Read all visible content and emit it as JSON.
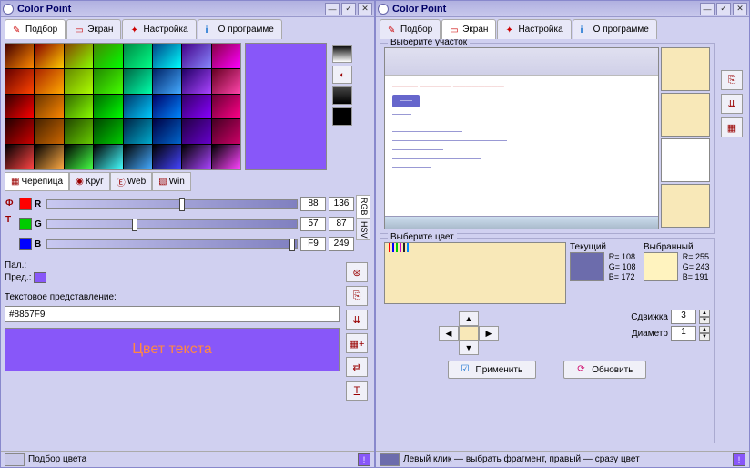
{
  "app_title": "Color Point",
  "tabs": {
    "pick": "Подбор",
    "screen": "Экран",
    "settings": "Настройка",
    "about": "О программе"
  },
  "pattern_tabs": {
    "tile": "Черепица",
    "circle": "Круг",
    "web": "Web",
    "win": "Win"
  },
  "rgb": {
    "r": {
      "label": "R",
      "hex": "88",
      "dec": "136",
      "pct": 53
    },
    "g": {
      "label": "G",
      "hex": "57",
      "dec": "87",
      "pct": 34
    },
    "b": {
      "label": "B",
      "hex": "F9",
      "dec": "249",
      "pct": 97
    }
  },
  "mode_tabs": {
    "rgb": "RGB",
    "hsv": "HSV"
  },
  "palette": {
    "pal_label": "Пал.:",
    "prev_label": "Пред.:",
    "text_repr_label": "Текстовое представление:",
    "hex_value": "#8857F9",
    "sample_text": "Цвет текста"
  },
  "colors": {
    "preview": "#8857F9",
    "sample_bg": "#8857F9",
    "sample_fg": "#ff8844"
  },
  "status_left": "Подбор цвета",
  "right": {
    "select_area": "Выберите участок",
    "select_color": "Выберите цвет",
    "current_label": "Текущий",
    "selected_label": "Выбранный",
    "current": {
      "r": "R= 108",
      "g": "G= 108",
      "b": "B= 172",
      "swatch": "#6c6cac"
    },
    "selected": {
      "r": "R= 255",
      "g": "G= 243",
      "b": "B= 191",
      "swatch": "#fff3bf"
    },
    "shift_label": "Сдвижка",
    "shift_val": "3",
    "diameter_label": "Диаметр",
    "diameter_val": "1",
    "apply": "Применить",
    "refresh": "Обновить",
    "status": "Левый клик — выбрать фрагмент, правый — сразу цвет"
  }
}
